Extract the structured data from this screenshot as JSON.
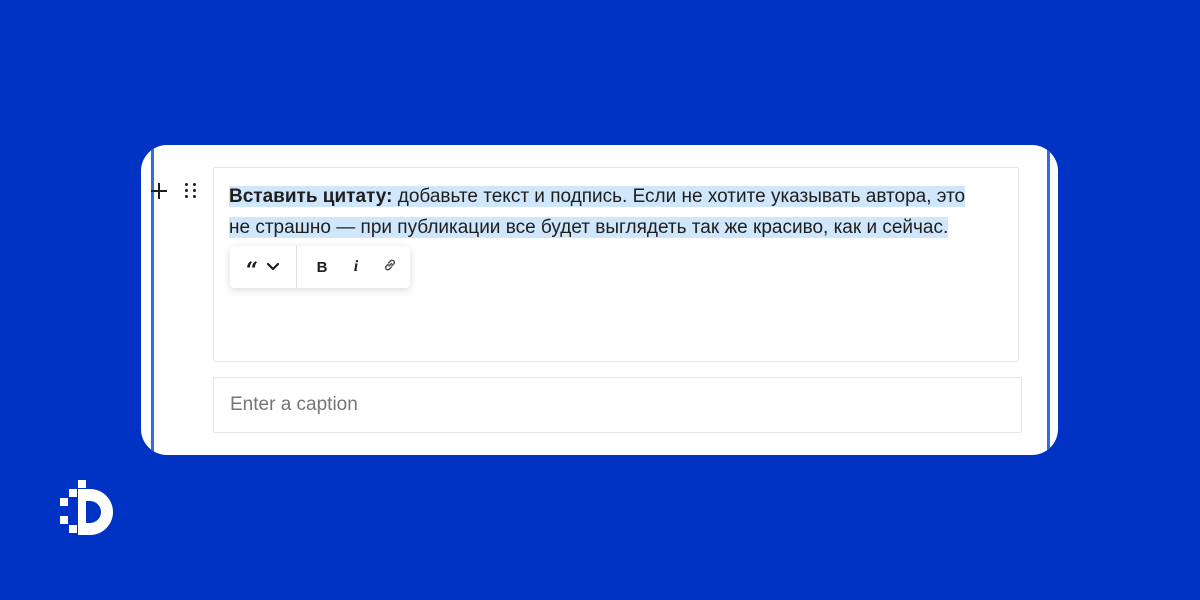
{
  "editor": {
    "quote": {
      "bold_prefix": "Вставить цитату:",
      "text_line_1": " добавьте текст и подпись. Если не хотите указывать автора, это",
      "text_line_2": "не страшно — при публикации все будет выглядеть так же красиво, как и сейчас."
    },
    "toolbar": {
      "quote_icon_glyph": "“",
      "bold_label": "B",
      "italic_label": "i"
    },
    "caption": {
      "placeholder": "Enter a caption",
      "value": ""
    }
  },
  "icons": {
    "add_block": "plus-icon",
    "drag_handle": "drag-handle-icon",
    "quote": "quote-icon",
    "chevron": "chevron-down-icon",
    "bold": "bold-icon",
    "italic": "italic-icon",
    "link": "link-icon",
    "logo": "brand-logo"
  },
  "colors": {
    "background": "#0033c4",
    "selection_highlight": "#cfe6fb",
    "card": "#ffffff",
    "edge_accent": "#2f6fe0"
  }
}
